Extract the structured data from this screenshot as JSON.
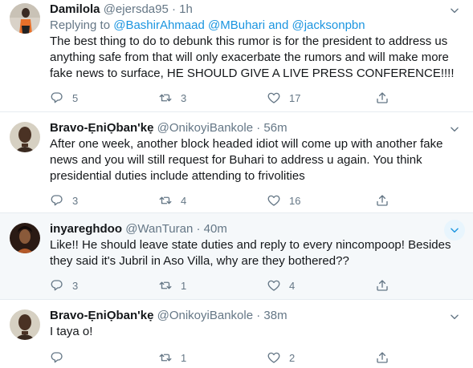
{
  "tweets": [
    {
      "name": "Damilola",
      "handle": "@ejersda95",
      "separator": "·",
      "time": "1h",
      "replying_prefix": "Replying to",
      "mention_1": "@BashirAhmaad",
      "mention_2": "@MBuhari",
      "replying_and": "and",
      "mention_3": "@jacksonpbn",
      "text_lines": [
        "The best thing to do to debunk this rumor is for the president to address us",
        "anything safe from that will only exacerbate the rumors and will make more",
        "fake news to surface, HE SHOULD GIVE A LIVE PRESS CONFERENCE!!!!"
      ],
      "replies": "5",
      "retweets": "3",
      "likes": "17"
    },
    {
      "name": "Bravo-ẸniỌban'kẹ",
      "handle": "@OnikoyiBankole",
      "separator": "·",
      "time": "56m",
      "text_lines": [
        "After one week, another block headed idiot will come up with another fake",
        "news and you will still request for Buhari to address u again. You think",
        "presidential duties include attending to frivolities"
      ],
      "replies": "3",
      "retweets": "4",
      "likes": "16"
    },
    {
      "name": "inyareghdoo",
      "handle": "@WanTuran",
      "separator": "·",
      "time": "40m",
      "text_lines": [
        "Like!! He should leave state duties and reply to every nincompoop! Besides",
        "they said it's Jubril in Aso Villa, why are they bothered??"
      ],
      "replies": "3",
      "retweets": "1",
      "likes": "4"
    },
    {
      "name": "Bravo-ẸniỌban'kẹ",
      "handle": "@OnikoyiBankole",
      "separator": "·",
      "time": "38m",
      "text_lines": [
        "I taya o!"
      ],
      "replies": "",
      "retweets": "1",
      "likes": "2"
    }
  ],
  "colors": {
    "link": "#1b95e0",
    "secondary": "#657786",
    "highlight_bg": "#f5f8fa",
    "divider": "#e6ecf0"
  },
  "icons": [
    "reply-icon",
    "retweet-icon",
    "like-icon",
    "share-icon",
    "chevron-down-icon"
  ]
}
